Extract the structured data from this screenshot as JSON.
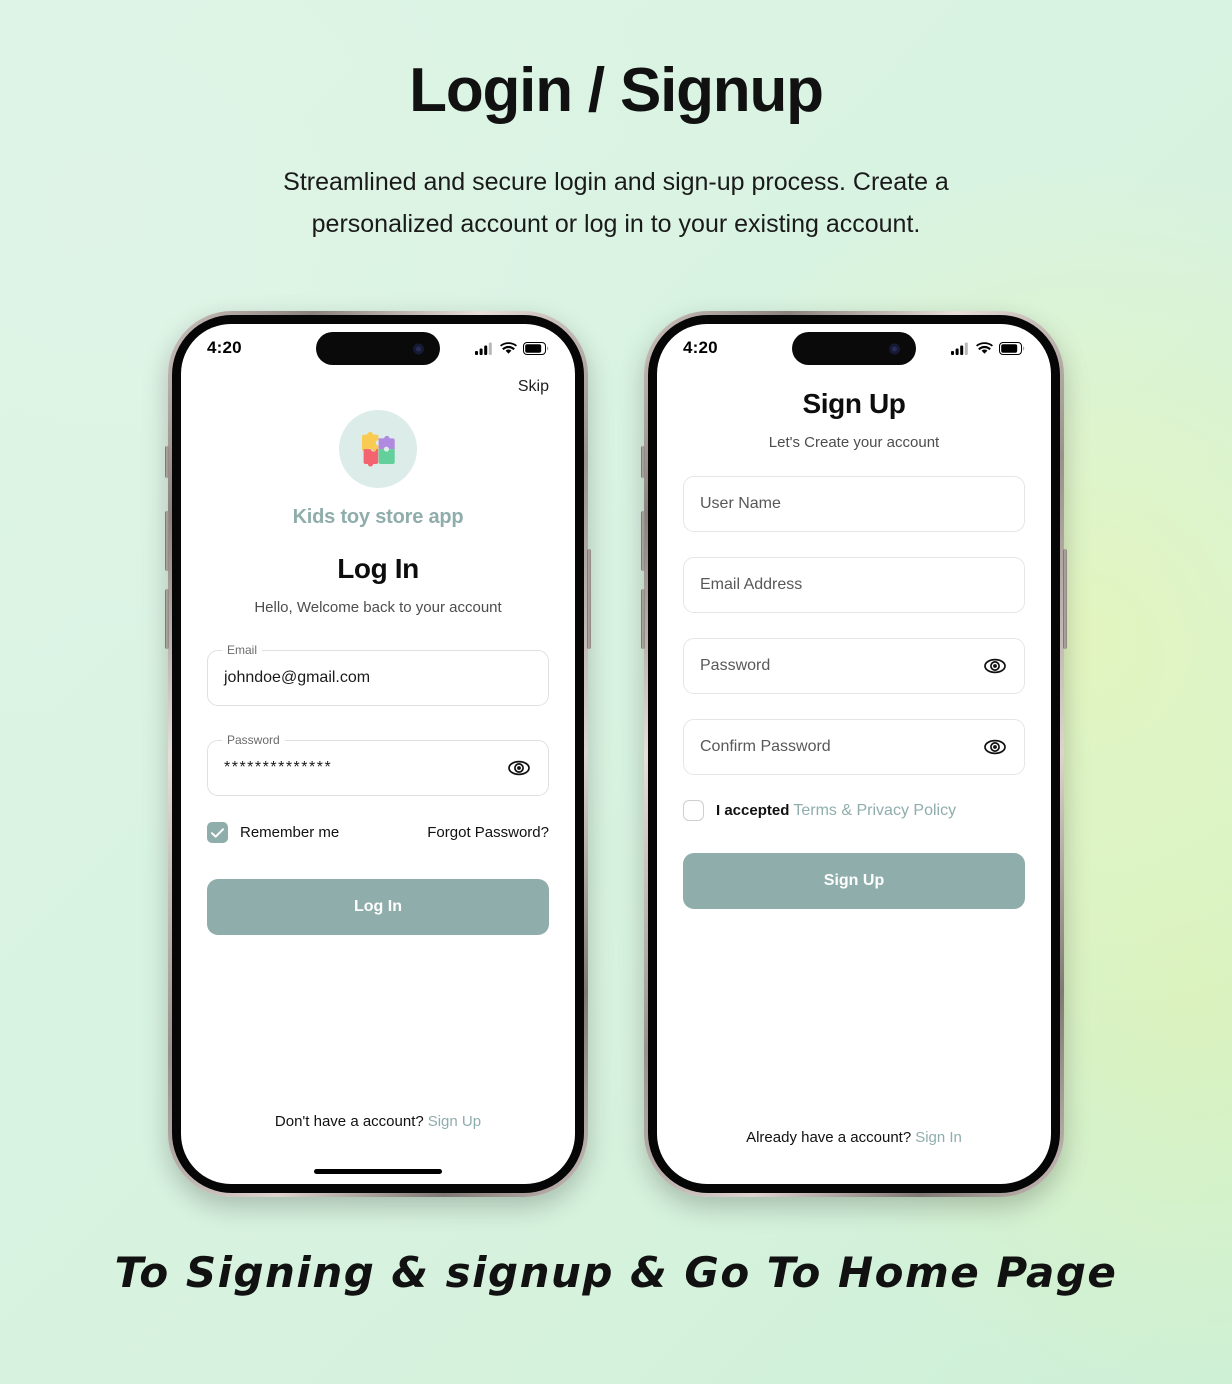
{
  "page": {
    "title": "Login / Signup",
    "subtitle": "Streamlined and secure login and sign-up process. Create a personalized account or log in to your existing account.",
    "footer_caption": "To Signing & signup & Go To Home Page"
  },
  "colors": {
    "accent": "#8fadab",
    "background_start": "#ddf4e5",
    "background_end": "#cdf0d6",
    "logo_bg": "#dcece8",
    "text_primary": "#111111",
    "text_muted": "#4d4d4d"
  },
  "status_bar": {
    "time": "4:20",
    "signal_icon": "cellular-signal-icon",
    "wifi_icon": "wifi-icon",
    "battery_icon": "battery-icon"
  },
  "login_screen": {
    "skip_label": "Skip",
    "logo_icon": "puzzle-pieces-logo-icon",
    "brand_name": "Kids toy store app",
    "title": "Log In",
    "subtitle": "Hello, Welcome back to your account",
    "fields": [
      {
        "label": "Email",
        "value": "johndoe@gmail.com",
        "name": "email-field",
        "has_eye": false
      },
      {
        "label": "Password",
        "value": "**************",
        "name": "password-field",
        "has_eye": true,
        "eye_icon": "eye-icon"
      }
    ],
    "remember_me_label": "Remember me",
    "remember_me_checked": true,
    "forgot_password_label": "Forgot Password?",
    "submit_label": "Log In",
    "bottom_prompt": "Don't have a account?",
    "bottom_link": "Sign Up"
  },
  "signup_screen": {
    "title": "Sign Up",
    "subtitle": "Let's Create your account",
    "fields": [
      {
        "placeholder": "User Name",
        "name": "username-field",
        "has_eye": false
      },
      {
        "placeholder": "Email Address",
        "name": "email-field",
        "has_eye": false
      },
      {
        "placeholder": "Password",
        "name": "password-field",
        "has_eye": true,
        "eye_icon": "eye-icon"
      },
      {
        "placeholder": "Confirm Password",
        "name": "confirm-password-field",
        "has_eye": true,
        "eye_icon": "eye-icon"
      }
    ],
    "terms_prefix": "I accepted",
    "terms_link": "Terms & Privacy Policy",
    "terms_checked": false,
    "submit_label": "Sign Up",
    "bottom_prompt": "Already have a account?",
    "bottom_link": "Sign In"
  }
}
